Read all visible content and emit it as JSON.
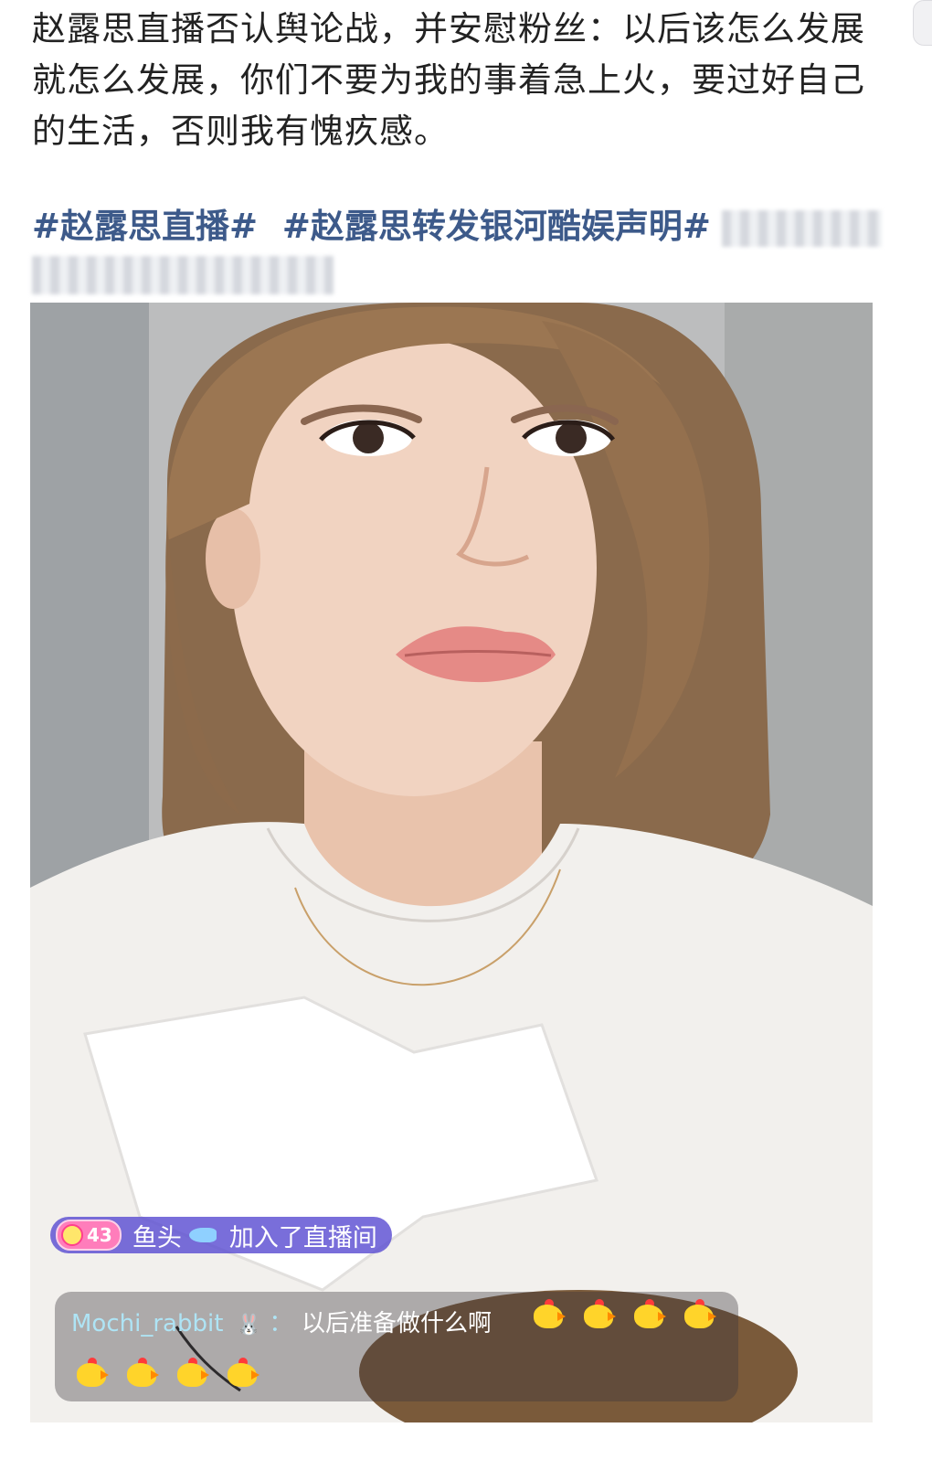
{
  "post": {
    "text": "赵露思直播否认舆论战，并安慰粉丝：以后该怎么发展就怎么发展，你们不要为我的事着急上火，要过好自己的生活，否则我有愧疚感。",
    "hashtags": [
      "#赵露思直播#",
      "#赵露思转发银河酷娱声明#"
    ]
  },
  "live": {
    "join_notice": {
      "level": "43",
      "user": "鱼头",
      "action": "加入了直播间"
    },
    "comment": {
      "user": "Mochi_rabbit",
      "separator": "：",
      "text": "以后准备做什么啊"
    }
  },
  "colors": {
    "hashtag": "#3d5a8a",
    "join_pill": "#5c4ed2",
    "level_badge": "#ff7dbb",
    "comment_user": "#aee4f5"
  },
  "icons": [
    "level-gem-icon",
    "fish-icon",
    "rabbit-icon",
    "chick-emoji-icon"
  ]
}
